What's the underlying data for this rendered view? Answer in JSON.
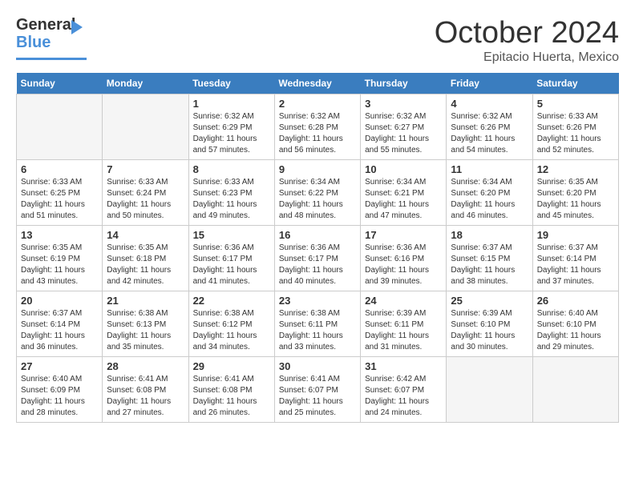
{
  "header": {
    "logo": {
      "line1": "General",
      "line2": "Blue"
    },
    "title": "October 2024",
    "subtitle": "Epitacio Huerta, Mexico"
  },
  "weekdays": [
    "Sunday",
    "Monday",
    "Tuesday",
    "Wednesday",
    "Thursday",
    "Friday",
    "Saturday"
  ],
  "weeks": [
    [
      {
        "day": "",
        "sunrise": "",
        "sunset": "",
        "daylight": ""
      },
      {
        "day": "",
        "sunrise": "",
        "sunset": "",
        "daylight": ""
      },
      {
        "day": "1",
        "sunrise": "Sunrise: 6:32 AM",
        "sunset": "Sunset: 6:29 PM",
        "daylight": "Daylight: 11 hours and 57 minutes."
      },
      {
        "day": "2",
        "sunrise": "Sunrise: 6:32 AM",
        "sunset": "Sunset: 6:28 PM",
        "daylight": "Daylight: 11 hours and 56 minutes."
      },
      {
        "day": "3",
        "sunrise": "Sunrise: 6:32 AM",
        "sunset": "Sunset: 6:27 PM",
        "daylight": "Daylight: 11 hours and 55 minutes."
      },
      {
        "day": "4",
        "sunrise": "Sunrise: 6:32 AM",
        "sunset": "Sunset: 6:26 PM",
        "daylight": "Daylight: 11 hours and 54 minutes."
      },
      {
        "day": "5",
        "sunrise": "Sunrise: 6:33 AM",
        "sunset": "Sunset: 6:26 PM",
        "daylight": "Daylight: 11 hours and 52 minutes."
      }
    ],
    [
      {
        "day": "6",
        "sunrise": "Sunrise: 6:33 AM",
        "sunset": "Sunset: 6:25 PM",
        "daylight": "Daylight: 11 hours and 51 minutes."
      },
      {
        "day": "7",
        "sunrise": "Sunrise: 6:33 AM",
        "sunset": "Sunset: 6:24 PM",
        "daylight": "Daylight: 11 hours and 50 minutes."
      },
      {
        "day": "8",
        "sunrise": "Sunrise: 6:33 AM",
        "sunset": "Sunset: 6:23 PM",
        "daylight": "Daylight: 11 hours and 49 minutes."
      },
      {
        "day": "9",
        "sunrise": "Sunrise: 6:34 AM",
        "sunset": "Sunset: 6:22 PM",
        "daylight": "Daylight: 11 hours and 48 minutes."
      },
      {
        "day": "10",
        "sunrise": "Sunrise: 6:34 AM",
        "sunset": "Sunset: 6:21 PM",
        "daylight": "Daylight: 11 hours and 47 minutes."
      },
      {
        "day": "11",
        "sunrise": "Sunrise: 6:34 AM",
        "sunset": "Sunset: 6:20 PM",
        "daylight": "Daylight: 11 hours and 46 minutes."
      },
      {
        "day": "12",
        "sunrise": "Sunrise: 6:35 AM",
        "sunset": "Sunset: 6:20 PM",
        "daylight": "Daylight: 11 hours and 45 minutes."
      }
    ],
    [
      {
        "day": "13",
        "sunrise": "Sunrise: 6:35 AM",
        "sunset": "Sunset: 6:19 PM",
        "daylight": "Daylight: 11 hours and 43 minutes."
      },
      {
        "day": "14",
        "sunrise": "Sunrise: 6:35 AM",
        "sunset": "Sunset: 6:18 PM",
        "daylight": "Daylight: 11 hours and 42 minutes."
      },
      {
        "day": "15",
        "sunrise": "Sunrise: 6:36 AM",
        "sunset": "Sunset: 6:17 PM",
        "daylight": "Daylight: 11 hours and 41 minutes."
      },
      {
        "day": "16",
        "sunrise": "Sunrise: 6:36 AM",
        "sunset": "Sunset: 6:17 PM",
        "daylight": "Daylight: 11 hours and 40 minutes."
      },
      {
        "day": "17",
        "sunrise": "Sunrise: 6:36 AM",
        "sunset": "Sunset: 6:16 PM",
        "daylight": "Daylight: 11 hours and 39 minutes."
      },
      {
        "day": "18",
        "sunrise": "Sunrise: 6:37 AM",
        "sunset": "Sunset: 6:15 PM",
        "daylight": "Daylight: 11 hours and 38 minutes."
      },
      {
        "day": "19",
        "sunrise": "Sunrise: 6:37 AM",
        "sunset": "Sunset: 6:14 PM",
        "daylight": "Daylight: 11 hours and 37 minutes."
      }
    ],
    [
      {
        "day": "20",
        "sunrise": "Sunrise: 6:37 AM",
        "sunset": "Sunset: 6:14 PM",
        "daylight": "Daylight: 11 hours and 36 minutes."
      },
      {
        "day": "21",
        "sunrise": "Sunrise: 6:38 AM",
        "sunset": "Sunset: 6:13 PM",
        "daylight": "Daylight: 11 hours and 35 minutes."
      },
      {
        "day": "22",
        "sunrise": "Sunrise: 6:38 AM",
        "sunset": "Sunset: 6:12 PM",
        "daylight": "Daylight: 11 hours and 34 minutes."
      },
      {
        "day": "23",
        "sunrise": "Sunrise: 6:38 AM",
        "sunset": "Sunset: 6:11 PM",
        "daylight": "Daylight: 11 hours and 33 minutes."
      },
      {
        "day": "24",
        "sunrise": "Sunrise: 6:39 AM",
        "sunset": "Sunset: 6:11 PM",
        "daylight": "Daylight: 11 hours and 31 minutes."
      },
      {
        "day": "25",
        "sunrise": "Sunrise: 6:39 AM",
        "sunset": "Sunset: 6:10 PM",
        "daylight": "Daylight: 11 hours and 30 minutes."
      },
      {
        "day": "26",
        "sunrise": "Sunrise: 6:40 AM",
        "sunset": "Sunset: 6:10 PM",
        "daylight": "Daylight: 11 hours and 29 minutes."
      }
    ],
    [
      {
        "day": "27",
        "sunrise": "Sunrise: 6:40 AM",
        "sunset": "Sunset: 6:09 PM",
        "daylight": "Daylight: 11 hours and 28 minutes."
      },
      {
        "day": "28",
        "sunrise": "Sunrise: 6:41 AM",
        "sunset": "Sunset: 6:08 PM",
        "daylight": "Daylight: 11 hours and 27 minutes."
      },
      {
        "day": "29",
        "sunrise": "Sunrise: 6:41 AM",
        "sunset": "Sunset: 6:08 PM",
        "daylight": "Daylight: 11 hours and 26 minutes."
      },
      {
        "day": "30",
        "sunrise": "Sunrise: 6:41 AM",
        "sunset": "Sunset: 6:07 PM",
        "daylight": "Daylight: 11 hours and 25 minutes."
      },
      {
        "day": "31",
        "sunrise": "Sunrise: 6:42 AM",
        "sunset": "Sunset: 6:07 PM",
        "daylight": "Daylight: 11 hours and 24 minutes."
      },
      {
        "day": "",
        "sunrise": "",
        "sunset": "",
        "daylight": ""
      },
      {
        "day": "",
        "sunrise": "",
        "sunset": "",
        "daylight": ""
      }
    ]
  ]
}
